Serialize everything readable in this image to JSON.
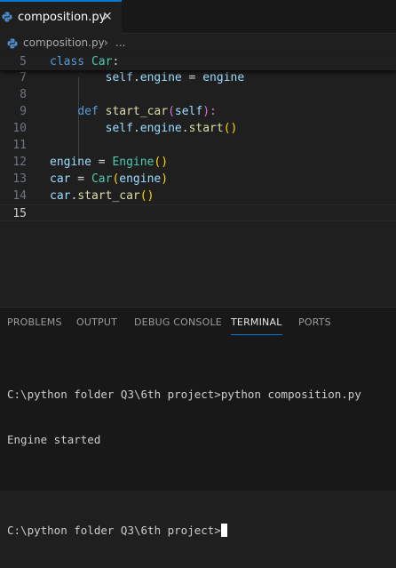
{
  "tab": {
    "filename": "composition.py",
    "close_glyph": "✕",
    "icon": "python-file-icon"
  },
  "breadcrumb": {
    "file": "composition.py",
    "separator": "›",
    "more": "..."
  },
  "editor": {
    "lines": [
      {
        "num": "5",
        "tokens": [
          {
            "t": "class ",
            "c": "kw"
          },
          {
            "t": "Car",
            "c": "cls"
          },
          {
            "t": ":",
            "c": "op"
          }
        ]
      },
      {
        "num": "7",
        "tokens": [
          {
            "t": "        ",
            "c": ""
          },
          {
            "t": "self",
            "c": "var"
          },
          {
            "t": ".",
            "c": "op"
          },
          {
            "t": "engine",
            "c": "var"
          },
          {
            "t": " = ",
            "c": "op"
          },
          {
            "t": "engine",
            "c": "var"
          }
        ]
      },
      {
        "num": "8",
        "tokens": []
      },
      {
        "num": "9",
        "tokens": [
          {
            "t": "    ",
            "c": ""
          },
          {
            "t": "def ",
            "c": "kw"
          },
          {
            "t": "start_car",
            "c": "fn"
          },
          {
            "t": "(",
            "c": "br2"
          },
          {
            "t": "self",
            "c": "var"
          },
          {
            "t": "):",
            "c": "br2"
          }
        ]
      },
      {
        "num": "10",
        "tokens": [
          {
            "t": "        ",
            "c": ""
          },
          {
            "t": "self",
            "c": "var"
          },
          {
            "t": ".",
            "c": "op"
          },
          {
            "t": "engine",
            "c": "var"
          },
          {
            "t": ".",
            "c": "op"
          },
          {
            "t": "start",
            "c": "fn"
          },
          {
            "t": "()",
            "c": "br"
          }
        ]
      },
      {
        "num": "11",
        "tokens": []
      },
      {
        "num": "12",
        "tokens": [
          {
            "t": "engine",
            "c": "var"
          },
          {
            "t": " = ",
            "c": "op"
          },
          {
            "t": "Engine",
            "c": "cls"
          },
          {
            "t": "()",
            "c": "br"
          }
        ]
      },
      {
        "num": "13",
        "tokens": [
          {
            "t": "car",
            "c": "var"
          },
          {
            "t": " = ",
            "c": "op"
          },
          {
            "t": "Car",
            "c": "cls"
          },
          {
            "t": "(",
            "c": "br"
          },
          {
            "t": "engine",
            "c": "var"
          },
          {
            "t": ")",
            "c": "br"
          }
        ]
      },
      {
        "num": "14",
        "tokens": [
          {
            "t": "car",
            "c": "var"
          },
          {
            "t": ".",
            "c": "op"
          },
          {
            "t": "start_car",
            "c": "fn"
          },
          {
            "t": "()",
            "c": "br"
          }
        ]
      },
      {
        "num": "15",
        "tokens": []
      }
    ]
  },
  "panel": {
    "tabs": [
      {
        "label": "PROBLEMS",
        "active": false
      },
      {
        "label": "OUTPUT",
        "active": false
      },
      {
        "label": "DEBUG CONSOLE",
        "active": false
      },
      {
        "label": "TERMINAL",
        "active": true
      },
      {
        "label": "PORTS",
        "active": false
      }
    ],
    "terminal_lines": [
      "C:\\python folder Q3\\6th project>python composition.py",
      "Engine started",
      "",
      "C:\\python folder Q3\\6th project>"
    ]
  },
  "colors": {
    "accent": "#0078d4",
    "background": "#1f1f1f",
    "panel": "#181818"
  }
}
